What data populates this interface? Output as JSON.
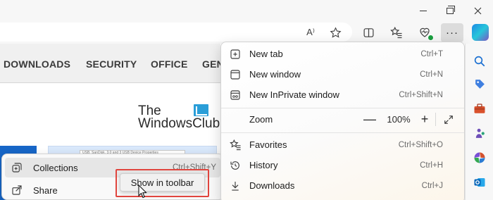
{
  "window_controls": {
    "minimize": "minimize",
    "maximize": "restore",
    "close": "close"
  },
  "toolbar": {
    "read_aloud_label": "A⁾",
    "more_label": "···"
  },
  "site_nav": {
    "items": [
      "DOWNLOADS",
      "SECURITY",
      "OFFICE",
      "GEN"
    ]
  },
  "logo": {
    "line1": "The",
    "line2": "WindowsClub"
  },
  "thumbnail_caption": "USB, SanDisk, 3.0 and 3 USB Device Properties",
  "left_menu": {
    "items": [
      {
        "label": "Collections",
        "shortcut": "Ctrl+Shift+Y",
        "icon": "collections-icon"
      },
      {
        "label": "Share",
        "shortcut": "",
        "icon": "share-icon"
      }
    ],
    "popup_label": "Show in toolbar"
  },
  "menu": {
    "items": [
      {
        "label": "New tab",
        "shortcut": "Ctrl+T",
        "icon": "new-tab-icon"
      },
      {
        "label": "New window",
        "shortcut": "Ctrl+N",
        "icon": "new-window-icon"
      },
      {
        "label": "New InPrivate window",
        "shortcut": "Ctrl+Shift+N",
        "icon": "inprivate-icon"
      },
      {
        "label": "Zoom",
        "shortcut": "",
        "icon": ""
      },
      {
        "label": "Favorites",
        "shortcut": "Ctrl+Shift+O",
        "icon": "favorites-icon"
      },
      {
        "label": "History",
        "shortcut": "Ctrl+H",
        "icon": "history-icon"
      },
      {
        "label": "Downloads",
        "shortcut": "Ctrl+J",
        "icon": "downloads-icon"
      }
    ],
    "zoom": {
      "minus": "—",
      "value": "100%",
      "plus": "+",
      "fullscreen": "⤢"
    }
  },
  "colors": {
    "highlight_outline": "#e0453e",
    "accent_blue": "#1a6fd1",
    "logo_blue": "#2a9ed8"
  }
}
